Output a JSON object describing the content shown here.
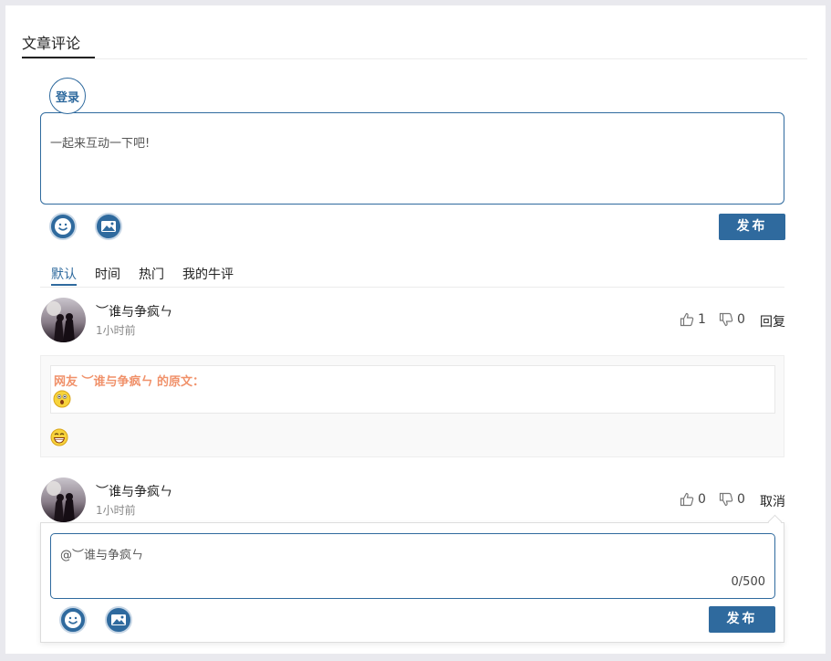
{
  "section": {
    "title": "文章评论"
  },
  "composer": {
    "login_label": "登录",
    "placeholder": "一起来互动一下吧!",
    "publish_label": "发布"
  },
  "sort_tabs": [
    {
      "label": "默认",
      "active": true
    },
    {
      "label": "时间",
      "active": false
    },
    {
      "label": "热门",
      "active": false
    },
    {
      "label": "我的牛评",
      "active": false
    }
  ],
  "comments": [
    {
      "username": "︶谁与争疯ㄣ",
      "time": "1小时前",
      "likes": "1",
      "dislikes": "0",
      "action": "回复",
      "quote_header": "网友 ︶谁与争疯ㄣ 的原文：",
      "quote_emoji": "surprised-emoji",
      "body_emoji": "grin-emoji"
    },
    {
      "username": "︶谁与争疯ㄣ",
      "time": "1小时前",
      "likes": "0",
      "dislikes": "0",
      "action": "取消"
    }
  ],
  "reply_box": {
    "value": "@︶谁与争疯ㄣ",
    "counter": "0/500",
    "publish_label": "发布"
  },
  "icons": {
    "emoji_button": "smiley-icon",
    "image_button": "image-icon",
    "like": "thumbs-up-icon",
    "dislike": "thumbs-down-icon"
  },
  "colors": {
    "accent": "#2f6a9e",
    "quote_header": "#f0916a",
    "page_bg": "#e9e9ee"
  }
}
